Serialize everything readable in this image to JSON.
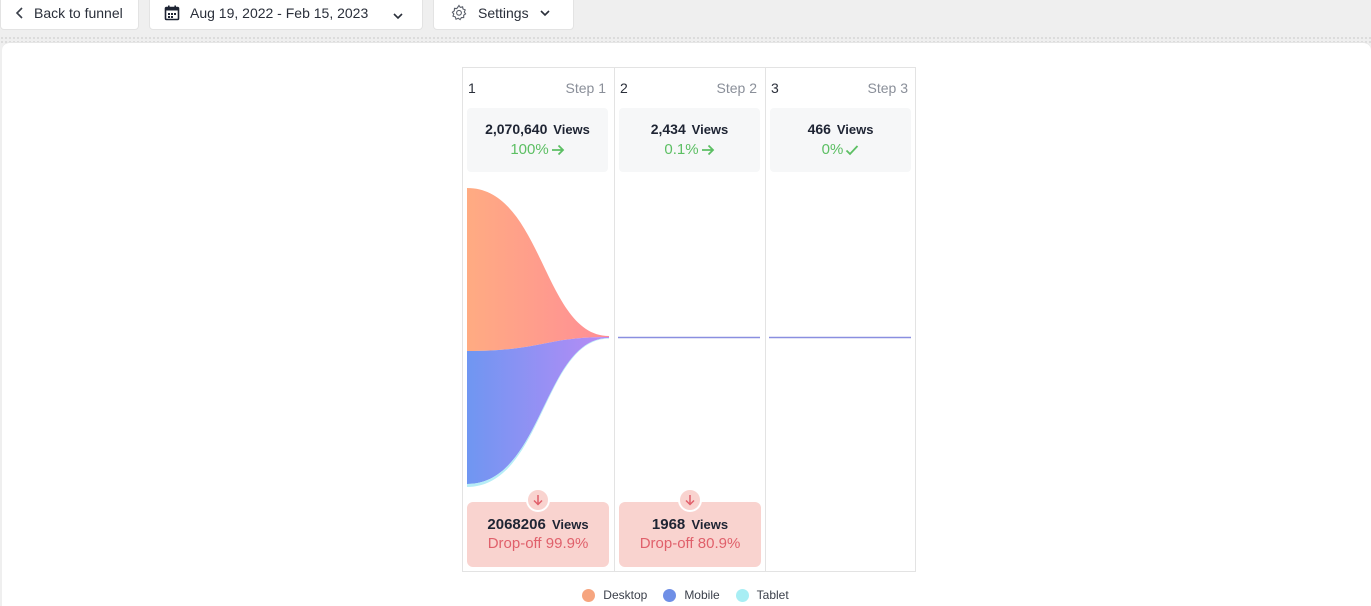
{
  "toolbar": {
    "back_label": "Back to funnel",
    "date_range": "Aug 19, 2022 - Feb 15, 2023",
    "settings_label": "Settings",
    "icons": [
      "chevron-left-icon",
      "calendar-icon",
      "chevron-down-icon",
      "gear-icon"
    ]
  },
  "funnel": {
    "unit": "Views",
    "steps": [
      {
        "num": "1",
        "name": "Step 1",
        "views": "2,070,640",
        "pct": "100%",
        "status_icon": "arrow-right-icon"
      },
      {
        "num": "2",
        "name": "Step 2",
        "views": "2,434",
        "pct": "0.1%",
        "status_icon": "arrow-right-icon"
      },
      {
        "num": "3",
        "name": "Step 3",
        "views": "466",
        "pct": "0%",
        "status_icon": "check-icon"
      }
    ],
    "dropoffs": [
      {
        "views": "2068206",
        "label": "Drop-off 99.9%"
      },
      {
        "views": "1968",
        "label": "Drop-off 80.9%"
      }
    ]
  },
  "legend": [
    {
      "label": "Desktop",
      "color": "#f6a57f"
    },
    {
      "label": "Mobile",
      "color": "#6f8fe6"
    },
    {
      "label": "Tablet",
      "color": "#a8eef4"
    }
  ],
  "colors": {
    "accent_green": "#5cbf63",
    "drop_red": "#e0606b",
    "drop_bg": "#f9d3cf",
    "desktop_grad": [
      "#ffaa84",
      "#ff8f93"
    ],
    "mobile_grad": [
      "#7297f0",
      "#b48cf4"
    ]
  }
}
